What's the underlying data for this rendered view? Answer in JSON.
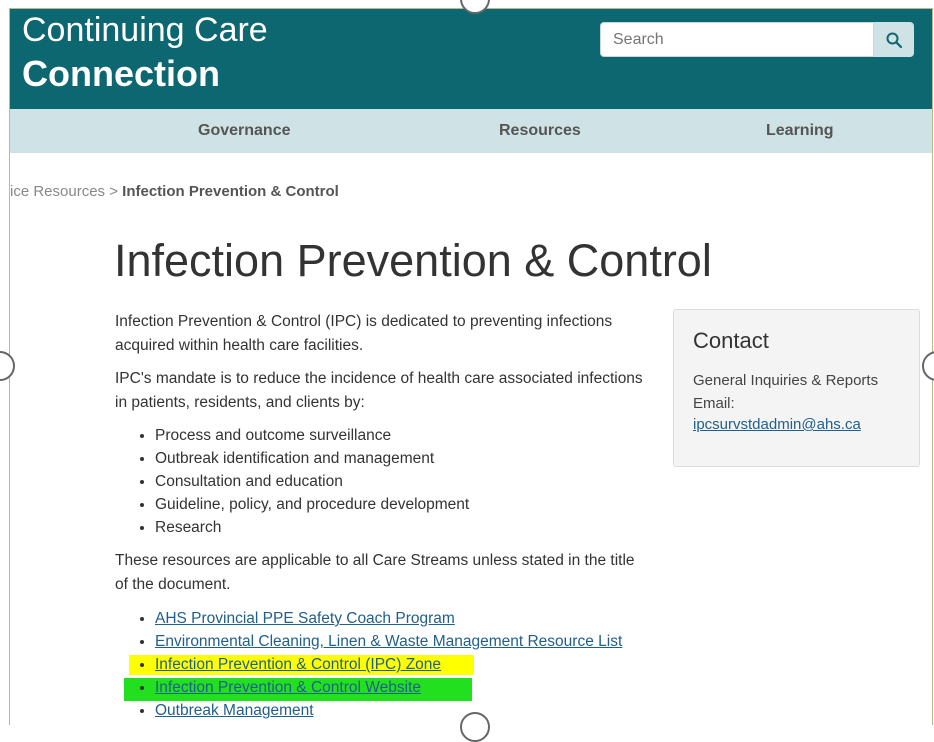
{
  "header": {
    "brand_line1": "Continuing Care",
    "brand_line2": "Connection",
    "search_placeholder": "Search",
    "search_icon": "search-icon",
    "bg_color": "#0c6771"
  },
  "nav": {
    "items": [
      {
        "label": "Governance"
      },
      {
        "label": "Resources"
      },
      {
        "label": "Learning"
      }
    ]
  },
  "breadcrumb": {
    "parent": "ice Resources",
    "separator": ">",
    "current": "Infection Prevention & Control"
  },
  "main": {
    "title": "Infection Prevention & Control",
    "intro": "Infection Prevention & Control (IPC) is dedicated to preventing infections acquired within health care facilities.",
    "mandate": "IPC's mandate is to reduce the incidence of health care associated infections in patients, residents, and clients by:",
    "mandate_items": [
      "Process and outcome surveillance",
      "Outbreak identification and management",
      "Consultation and education",
      "Guideline, policy, and procedure development",
      "Research"
    ],
    "applicability": "These resources are applicable to all Care Streams unless stated in the title of the document.",
    "resource_links": [
      "AHS Provincial PPE Safety Coach Program",
      "Environmental Cleaning, Linen & Waste Management Resource List",
      "Infection Prevention & Control (IPC) Zone",
      "Infection Prevention & Control Website",
      "Outbreak Management"
    ],
    "highlight_colors": {
      "yellow": "#ffff00",
      "green": "#22e01f"
    }
  },
  "contact": {
    "title": "Contact",
    "line1": "General Inquiries & Reports",
    "line2": "Email:",
    "email": "ipcsurvstdadmin@ahs.ca"
  }
}
